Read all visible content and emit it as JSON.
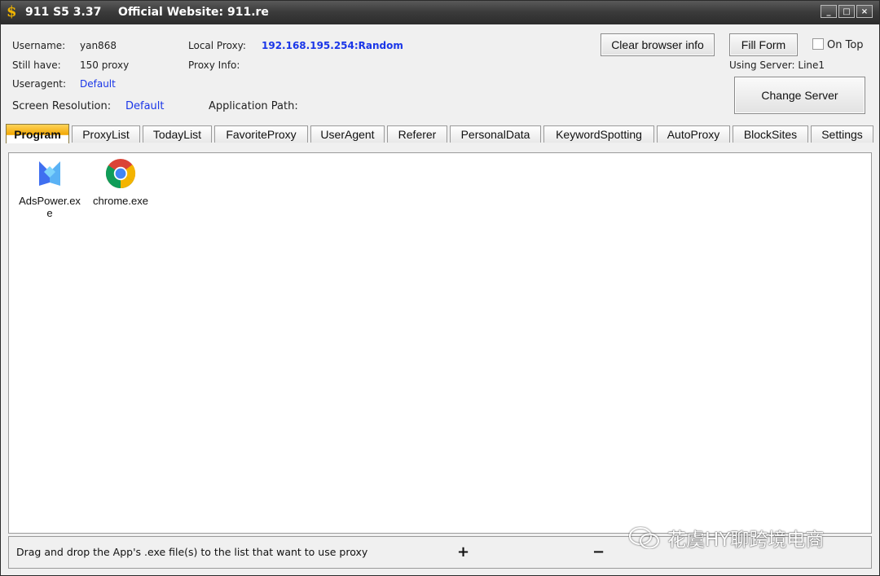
{
  "titlebar": {
    "app_title": "911 S5 3.37",
    "website": "Official Website:  911.re",
    "min_label": "_",
    "max_label": "□",
    "close_label": "×"
  },
  "account": {
    "username_label": "Username:",
    "username_value": "yan868",
    "still_have_label": "Still have:",
    "still_have_value": "150  proxy",
    "useragent_label": "Useragent:",
    "useragent_value": "Default",
    "screen_res_label": "Screen Resolution:",
    "screen_res_value": "Default",
    "local_proxy_label": "Local Proxy:",
    "local_proxy_value": "192.168.195.254:Random",
    "proxy_info_label": "Proxy Info:",
    "app_path_label": "Application Path:"
  },
  "buttons": {
    "clear_browser": "Clear browser info",
    "fill_form": "Fill Form",
    "on_top": "On Top",
    "using_server": "Using Server: Line1",
    "change_server": "Change Server"
  },
  "tabs": [
    "Program",
    "ProxyList",
    "TodayList",
    "FavoriteProxy",
    "UserAgent",
    "Referer",
    "PersonalData",
    "KeywordSpotting",
    "AutoProxy",
    "BlockSites",
    "Settings"
  ],
  "programs": [
    {
      "name": "AdsPower.exe",
      "icon": "adspower-icon"
    },
    {
      "name": "chrome.exe",
      "icon": "chrome-icon"
    }
  ],
  "footer": {
    "hint": "Drag and drop the App's .exe file(s) to the list that want to use proxy",
    "add": "+",
    "remove": "−"
  },
  "watermark": "花虞HY聊跨境电商",
  "colors": {
    "accent_blue": "#1a36e8",
    "active_tab": "#f2a700",
    "title_dollar": "#f0b400"
  }
}
